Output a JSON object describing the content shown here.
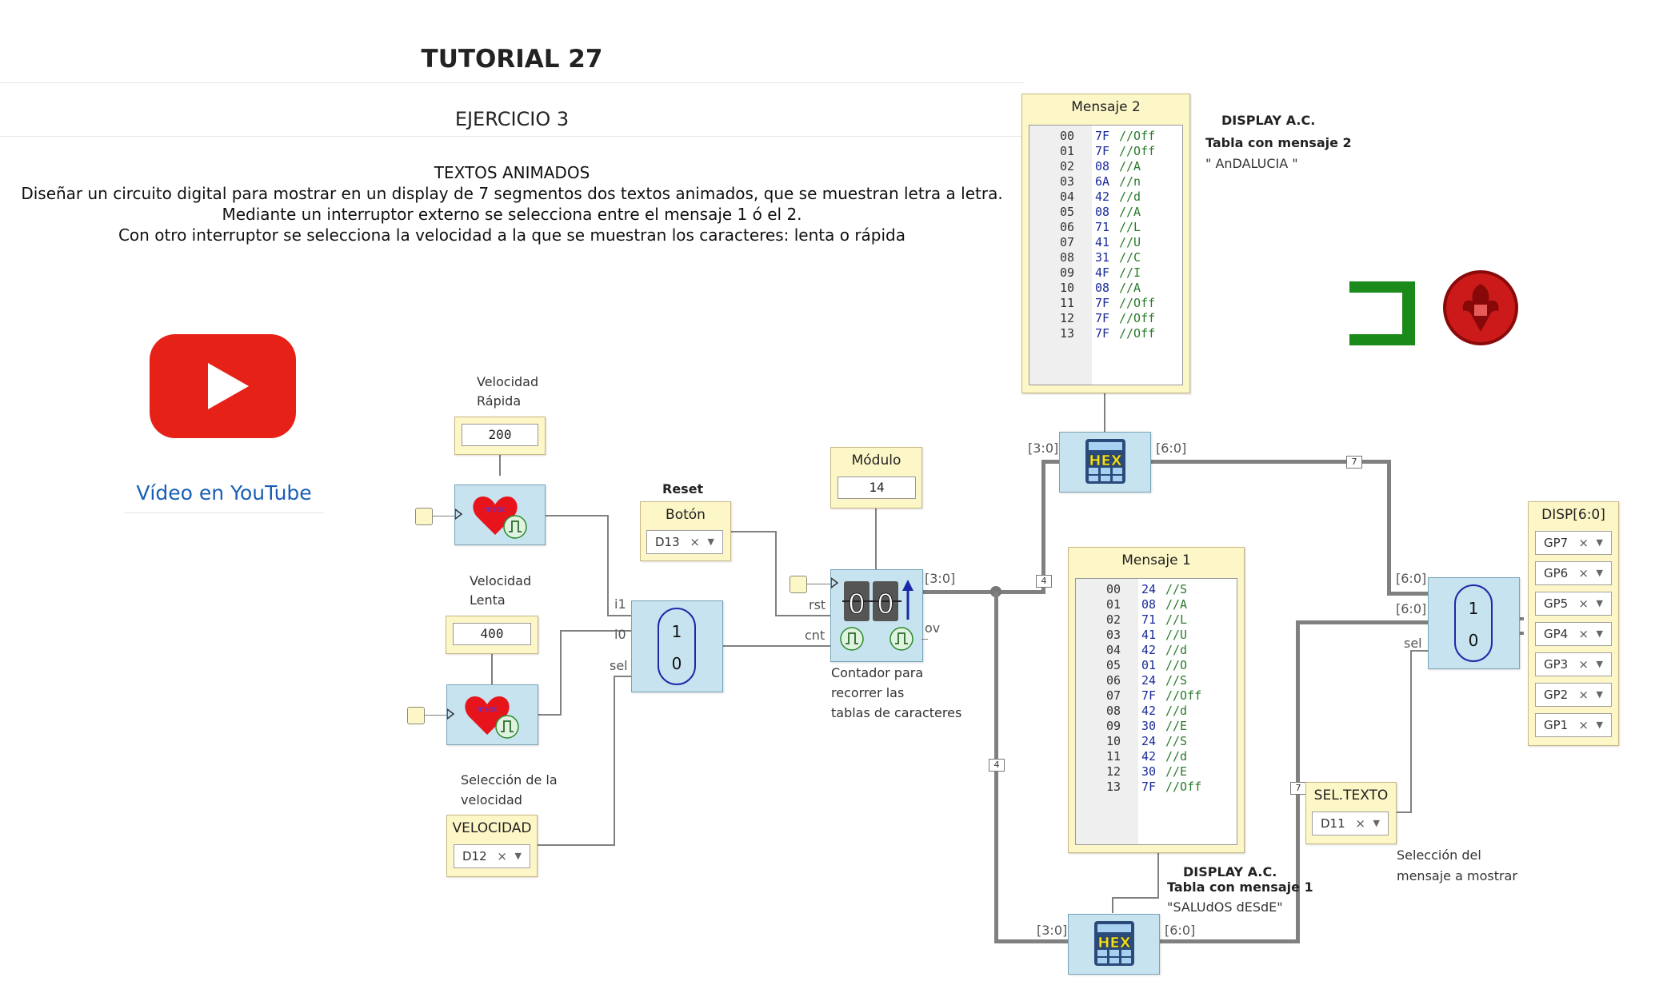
{
  "header": {
    "title": "TUTORIAL 27",
    "subtitle": "EJERCICIO 3",
    "desc_title": "TEXTOS ANIMADOS",
    "desc_lines": [
      "Diseñar un circuito digital para mostrar en un display de 7 segmentos dos textos animados, que se muestran letra a letra.",
      "Mediante un interruptor externo se selecciona entre el mensaje 1 ó el 2.",
      "Con otro interruptor se selecciona la velocidad a la que se muestran los caracteres: lenta o rápida"
    ]
  },
  "youtube": {
    "link_text": "Vídeo en YouTube",
    "accent": "#e62117",
    "link_color": "#1a5fb4"
  },
  "clocks": {
    "fast_label_1": "Velocidad",
    "fast_label_2": "Rápida",
    "fast_value": "200",
    "slow_label_1": "Velocidad",
    "slow_label_2": "Lenta",
    "slow_value": "400",
    "clock_icon_text": "msec"
  },
  "speed_select": {
    "label_1": "Selección de la",
    "label_2": "velocidad",
    "title": "VELOCIDAD",
    "pin": "D12"
  },
  "mux1": {
    "i1": "i1",
    "i0": "i0",
    "sel": "sel",
    "top": "1",
    "bottom": "0"
  },
  "reset": {
    "label": "Reset",
    "title": "Botón",
    "pin": "D13"
  },
  "modulo": {
    "title": "Módulo",
    "value": "14"
  },
  "counter": {
    "rst": "rst",
    "cnt": "cnt",
    "out": "[3:0]",
    "ov": "ov",
    "digits": "00",
    "desc_1": "Contador para",
    "desc_2": "recorrer las",
    "desc_3": "tablas de caracteres"
  },
  "rom2": {
    "title": "Mensaje 2",
    "rows": [
      {
        "a": "00",
        "v": "7F",
        "c": "//Off"
      },
      {
        "a": "01",
        "v": "7F",
        "c": "//Off"
      },
      {
        "a": "02",
        "v": "08",
        "c": "//A"
      },
      {
        "a": "03",
        "v": "6A",
        "c": "//n"
      },
      {
        "a": "04",
        "v": "42",
        "c": "//d"
      },
      {
        "a": "05",
        "v": "08",
        "c": "//A"
      },
      {
        "a": "06",
        "v": "71",
        "c": "//L"
      },
      {
        "a": "07",
        "v": "41",
        "c": "//U"
      },
      {
        "a": "08",
        "v": "31",
        "c": "//C"
      },
      {
        "a": "09",
        "v": "4F",
        "c": "//I"
      },
      {
        "a": "10",
        "v": "08",
        "c": "//A"
      },
      {
        "a": "11",
        "v": "7F",
        "c": "//Off"
      },
      {
        "a": "12",
        "v": "7F",
        "c": "//Off"
      },
      {
        "a": "13",
        "v": "7F",
        "c": "//Off"
      }
    ],
    "note_title": "DISPLAY A.C.",
    "note_sub": "Tabla con mensaje 2",
    "note_text": "\" AnDALUCIA \""
  },
  "rom1": {
    "title": "Mensaje 1",
    "rows": [
      {
        "a": "00",
        "v": "24",
        "c": "//S"
      },
      {
        "a": "01",
        "v": "08",
        "c": "//A"
      },
      {
        "a": "02",
        "v": "71",
        "c": "//L"
      },
      {
        "a": "03",
        "v": "41",
        "c": "//U"
      },
      {
        "a": "04",
        "v": "42",
        "c": "//d"
      },
      {
        "a": "05",
        "v": "01",
        "c": "//O"
      },
      {
        "a": "06",
        "v": "24",
        "c": "//S"
      },
      {
        "a": "07",
        "v": "7F",
        "c": "//Off"
      },
      {
        "a": "08",
        "v": "42",
        "c": "//d"
      },
      {
        "a": "09",
        "v": "30",
        "c": "//E"
      },
      {
        "a": "10",
        "v": "24",
        "c": "//S"
      },
      {
        "a": "11",
        "v": "42",
        "c": "//d"
      },
      {
        "a": "12",
        "v": "30",
        "c": "//E"
      },
      {
        "a": "13",
        "v": "7F",
        "c": "//Off"
      }
    ],
    "note_title": "DISPLAY A.C.",
    "note_sub": "Tabla con mensaje 1",
    "note_text": "\"SALUdOS dESdE\""
  },
  "hex_blocks": {
    "label": "HEX",
    "in": "[3:0]",
    "out": "[6:0]"
  },
  "bus_badges": {
    "b4": "4",
    "b7": "7"
  },
  "mux2": {
    "in1": "[6:0]",
    "in0": "[6:0]",
    "sel": "sel",
    "top": "1",
    "bottom": "0"
  },
  "text_select": {
    "title": "SEL.TEXTO",
    "pin": "D11",
    "label_1": "Selección del",
    "label_2": "mensaje a mostrar"
  },
  "display_out": {
    "title": "DISP[6:0]",
    "pins": [
      "GP7",
      "GP6",
      "GP5",
      "GP4",
      "GP3",
      "GP2",
      "GP1"
    ]
  },
  "colors": {
    "wire": "#808080",
    "yellow_box": "#fdf6c7",
    "blue_block": "#c7e3ef",
    "mux_outline": "#1c2aa8",
    "logo_green": "#1a8a1a",
    "logo_red": "#cc1a1a"
  }
}
